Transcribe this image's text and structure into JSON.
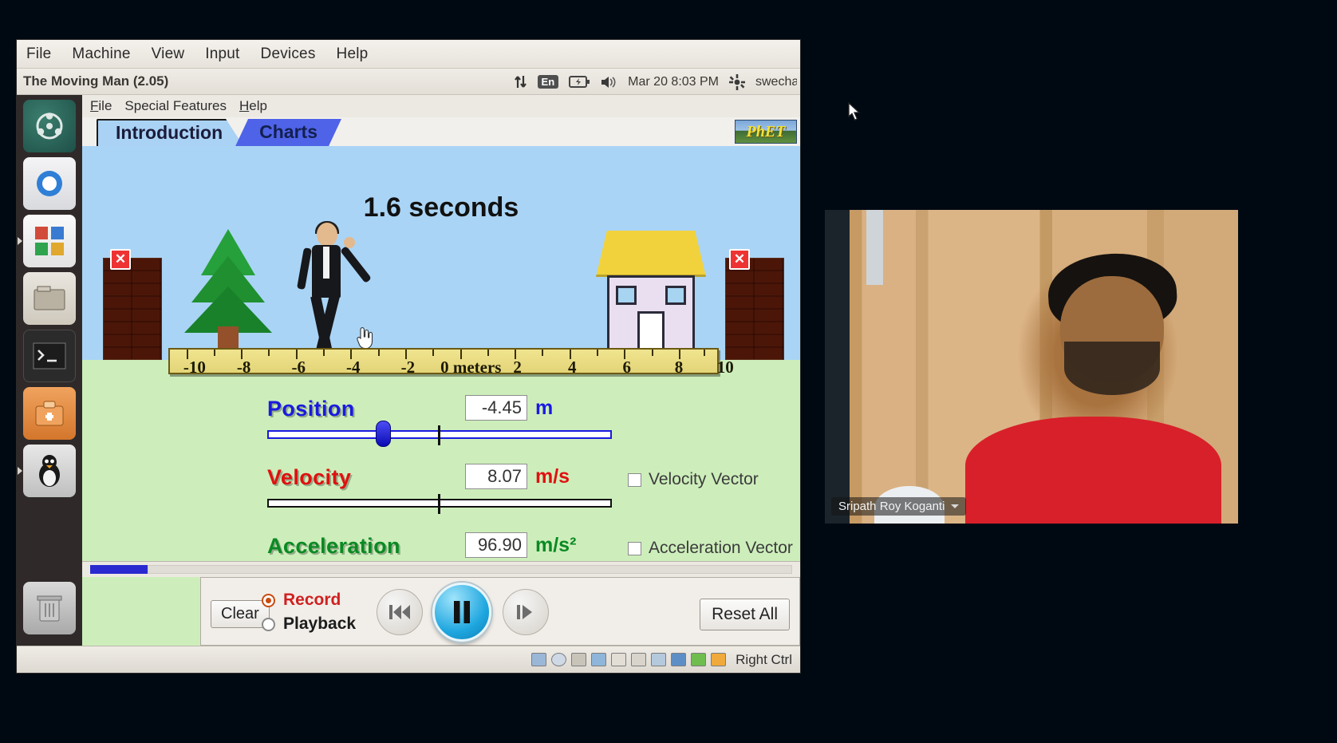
{
  "vbox": {
    "menu": [
      "File",
      "Machine",
      "View",
      "Input",
      "Devices",
      "Help"
    ],
    "window_title": "The Moving Man (2.05)",
    "tray": {
      "network_icon": "up-down-arrows-icon",
      "language": "En",
      "battery_icon": "battery-charging-icon",
      "volume_icon": "speaker-icon",
      "clock": "Mar 20  8:03 PM",
      "settings_icon": "gear-icon",
      "user": "swecha"
    },
    "status_bar": {
      "host_key_label": "Right Ctrl",
      "icons": [
        "hard-disk-icon",
        "optical-disk-icon",
        "floppy-icon",
        "network-icon",
        "usb-icon",
        "shared-folder-icon",
        "display-icon",
        "recording-icon",
        "mouse-capture-icon",
        "keyboard-icon"
      ]
    }
  },
  "launcher": {
    "items": [
      {
        "name": "ubuntu-dash-icon",
        "label": "Dash home"
      },
      {
        "name": "chromium-icon",
        "label": "Chromium"
      },
      {
        "name": "applications-icon",
        "label": "Applications"
      },
      {
        "name": "files-icon",
        "label": "Files"
      },
      {
        "name": "terminal-icon",
        "label": "Terminal"
      },
      {
        "name": "software-center-icon",
        "label": "Ubuntu Software"
      },
      {
        "name": "tux-icon",
        "label": "Java"
      },
      {
        "name": "trash-icon",
        "label": "Trash"
      }
    ]
  },
  "sim": {
    "menu": [
      "File",
      "Special Features",
      "Help"
    ],
    "tabs": [
      {
        "label": "Introduction",
        "active": true
      },
      {
        "label": "Charts",
        "active": false
      }
    ],
    "logo": "PhET",
    "timer": "1.6 seconds",
    "wall_close_label": "✕",
    "ruler": {
      "unit_label": "0 meters",
      "ticks": [
        {
          "value": -10,
          "label": "-10"
        },
        {
          "value": -8,
          "label": "-8"
        },
        {
          "value": -6,
          "label": "-6"
        },
        {
          "value": -4,
          "label": "-4"
        },
        {
          "value": -2,
          "label": "-2"
        },
        {
          "value": 0,
          "label": "0 meters"
        },
        {
          "value": 2,
          "label": "2"
        },
        {
          "value": 4,
          "label": "4"
        },
        {
          "value": 6,
          "label": "6"
        },
        {
          "value": 8,
          "label": "8"
        },
        {
          "value": 10,
          "label": "10"
        }
      ]
    },
    "controls": [
      {
        "id": "position",
        "label": "Position",
        "value": "-4.45",
        "unit": "m",
        "color": "#1a1ae0",
        "knob_percent": 33.5,
        "has_vector_checkbox": false,
        "vector_label": "",
        "vector_checked": false
      },
      {
        "id": "velocity",
        "label": "Velocity",
        "value": "8.07",
        "unit": "m/s",
        "color": "#e01010",
        "knob_percent": null,
        "has_vector_checkbox": true,
        "vector_label": "Velocity Vector",
        "vector_checked": false
      },
      {
        "id": "acceleration",
        "label": "Acceleration",
        "value": "96.90",
        "unit": "m/s²",
        "color": "#0a8a23",
        "knob_percent": null,
        "has_vector_checkbox": true,
        "vector_label": "Acceleration Vector",
        "vector_checked": false
      }
    ],
    "playback": {
      "clear_label": "Clear",
      "record_label": "Record",
      "record_selected": true,
      "playback_label": "Playback",
      "playback_selected": false,
      "rewind_icon": "rewind-to-start-icon",
      "pause_icon": "pause-icon",
      "step_icon": "step-forward-icon",
      "reset_label": "Reset All",
      "timeline_progress_percent": 8
    }
  },
  "webcam": {
    "participant_name": "Sripath Roy Koganti",
    "menu_icon": "chevron-down-icon"
  },
  "cursor": {
    "desktop_icon": "arrow-pointer-icon",
    "sim_icon": "pointing-hand-icon"
  }
}
